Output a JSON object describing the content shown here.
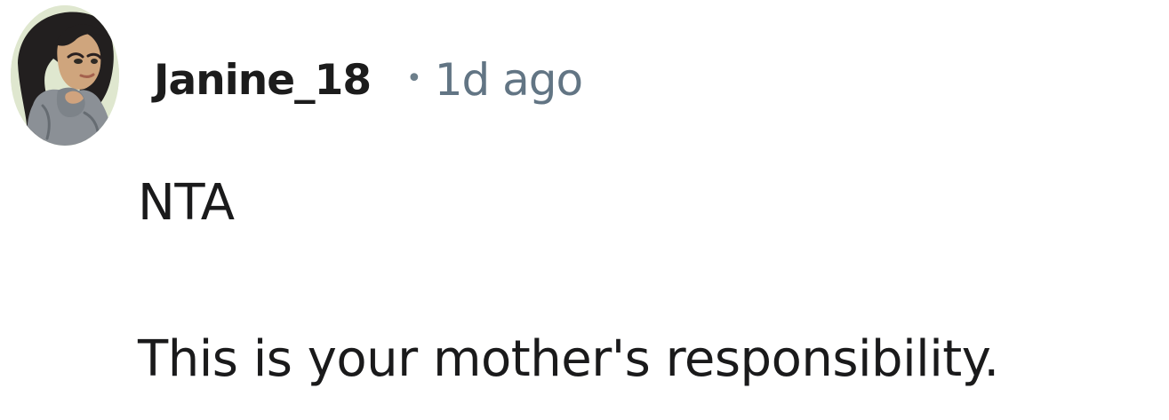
{
  "comment": {
    "avatar_icon": "avatar-illustration-icon",
    "username": "Janine_18",
    "separator": "•",
    "timestamp": "1d ago",
    "paragraphs": [
      "NTA",
      "This is your mother's responsibility."
    ]
  },
  "colors": {
    "username": "#1c1c1c",
    "timestamp": "#627584",
    "body_text": "#1a1a1b",
    "background": "#ffffff"
  }
}
